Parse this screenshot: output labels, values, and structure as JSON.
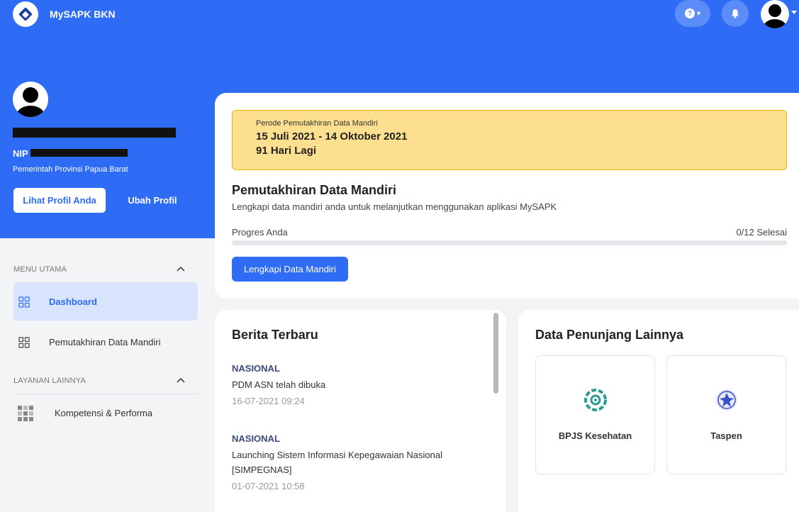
{
  "header": {
    "app_title": "MySAPK BKN",
    "help_icon": "question-circle-icon",
    "bell_icon": "bell-icon"
  },
  "profile": {
    "nip_label": "NIP",
    "instansi": "Pemerintah Provinsi Papua Barat",
    "view_profile_label": "Lihat Profil Anda",
    "edit_profile_label": "Ubah Profil"
  },
  "sidebar": {
    "sections": [
      {
        "label": "MENU UTAMA"
      },
      {
        "label": "LAYANAN LAINNYA"
      }
    ],
    "items": [
      {
        "label": "Dashboard",
        "icon": "grid-icon",
        "active": true
      },
      {
        "label": "Pemutakhiran Data Mandiri",
        "icon": "grid-icon"
      },
      {
        "label": "Kompetensi & Performa",
        "icon": "apps-icon"
      }
    ]
  },
  "period": {
    "label": "Perode Pemutakhiran Data Mandiri",
    "dates": "15 Juli 2021 - 14 Oktober 2021",
    "days_left": "91 Hari Lagi"
  },
  "pdm": {
    "title": "Pemutakhiran Data Mandiri",
    "subtitle": "Lengkapi data mandiri anda untuk melanjutkan menggunakan aplikasi MySAPK",
    "progress_label": "Progres Anda",
    "progress_count": "0/12 Selesai",
    "progress_fraction": 0,
    "button_label": "Lengkapi Data Mandiri"
  },
  "news": {
    "title": "Berita Terbaru",
    "items": [
      {
        "category": "NASIONAL",
        "headline": "PDM ASN telah dibuka",
        "date": "16-07-2021 09:24"
      },
      {
        "category": "NASIONAL",
        "headline": "Launching Sistem Informasi Kepegawaian Nasional [SIMPEGNAS]",
        "date": "01-07-2021 10:58"
      }
    ]
  },
  "support": {
    "title": "Data Penunjang Lainnya",
    "tiles": [
      {
        "label": "BPJS Kesehatan",
        "icon": "bpjs-logo-icon",
        "color": "#2a9d8f"
      },
      {
        "label": "Taspen",
        "icon": "taspen-logo-icon",
        "color": "#3a4ec8"
      }
    ]
  },
  "colors": {
    "primary": "#2e6cf6",
    "period_bg": "#fde08f",
    "period_border": "#f0b400"
  }
}
